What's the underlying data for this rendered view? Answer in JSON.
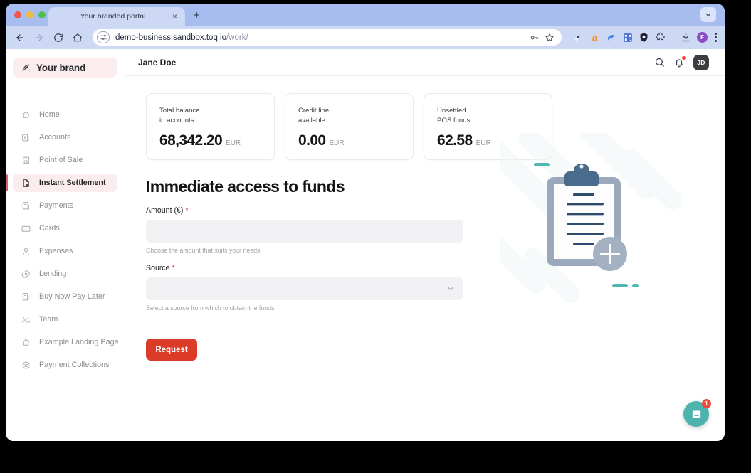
{
  "browser": {
    "tab_title": "Your branded portal",
    "new_tab_label": "+",
    "close_label": "×",
    "url_host": "demo-business.sandbox.toq.io",
    "url_path": "/work/",
    "profile_initial": "F",
    "nav": {
      "back": "back-arrow",
      "forward": "forward-arrow",
      "reload": "reload",
      "home": "home"
    },
    "extensions": [
      "extension-pen-icon",
      "extension-amazon-icon",
      "extension-ribbon-icon",
      "extension-qr-icon",
      "extension-shield-icon",
      "extension-puzzle-icon",
      "downloads-icon"
    ]
  },
  "sidebar": {
    "brand_name": "Your brand",
    "brand_icon": "feather-icon",
    "items": [
      {
        "label": "Home",
        "icon": "home-icon",
        "active": false
      },
      {
        "label": "Accounts",
        "icon": "accounts-icon",
        "active": false
      },
      {
        "label": "Point of Sale",
        "icon": "store-icon",
        "active": false
      },
      {
        "label": "Instant Settlement",
        "icon": "document-bolt-icon",
        "active": true
      },
      {
        "label": "Payments",
        "icon": "payments-icon",
        "active": false
      },
      {
        "label": "Cards",
        "icon": "card-icon",
        "active": false
      },
      {
        "label": "Expenses",
        "icon": "person-icon",
        "active": false
      },
      {
        "label": "Lending",
        "icon": "lending-icon",
        "active": false
      },
      {
        "label": "Buy Now Pay Later",
        "icon": "bnpl-icon",
        "active": false
      },
      {
        "label": "Team",
        "icon": "team-icon",
        "active": false
      },
      {
        "label": "Example Landing Page",
        "icon": "home-outline-icon",
        "active": false
      },
      {
        "label": "Payment Collections",
        "icon": "layers-icon",
        "active": false
      }
    ]
  },
  "header": {
    "user_name": "Jane Doe",
    "search_icon": "search-icon",
    "notifications_icon": "bell-icon",
    "avatar_initials": "JD"
  },
  "cards": [
    {
      "label_line1": "Total balance",
      "label_line2": "in accounts",
      "value": "68,342.20",
      "currency": "EUR"
    },
    {
      "label_line1": "Credit line",
      "label_line2": "available",
      "value": "0.00",
      "currency": "EUR"
    },
    {
      "label_line1": "Unsettled",
      "label_line2": "POS funds",
      "value": "62.58",
      "currency": "EUR"
    }
  ],
  "form": {
    "title": "Immediate access to funds",
    "amount": {
      "label": "Amount (€)",
      "required_mark": "*",
      "value": "",
      "placeholder": "",
      "hint": "Choose the amount that suits your needs."
    },
    "source": {
      "label": "Source",
      "required_mark": "*",
      "value": "",
      "placeholder": "",
      "hint": "Select a source from which to obtain the funds.",
      "chevron_icon": "chevron-down-icon"
    },
    "submit_label": "Request"
  },
  "illustration": {
    "name": "clipboard-add-illustration"
  },
  "chat": {
    "icon": "chat-message-icon",
    "badge_count": "1"
  },
  "colors": {
    "brand_accent": "#dc3b28",
    "brand_tint": "#fbeced",
    "chat_teal": "#4eb3ad",
    "badge_red": "#ec4a3c",
    "required_red": "#e23a3a"
  }
}
